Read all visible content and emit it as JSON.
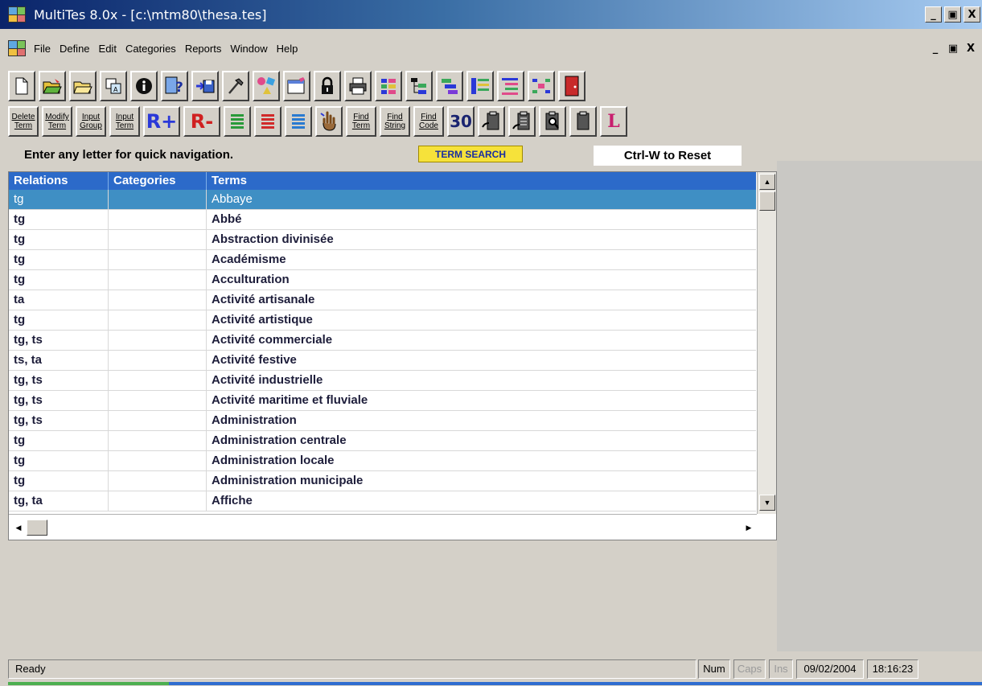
{
  "window": {
    "title": "MultiTes 8.0x - [c:\\mtm80\\thesa.tes]",
    "controls": [
      "_",
      "▣",
      "X"
    ]
  },
  "menubar": {
    "items": [
      "File",
      "Define",
      "Edit",
      "Categories",
      "Reports",
      "Window",
      "Help"
    ],
    "mdi_controls": [
      "_",
      "▣",
      "X"
    ]
  },
  "toolbar2": {
    "delete_term": [
      "Delete",
      "Term"
    ],
    "modify_term": [
      "Modify",
      "Term"
    ],
    "input_group": [
      "Input",
      "Group"
    ],
    "input_term": [
      "Input",
      "Term"
    ],
    "r_plus": "R+",
    "r_minus": "R-",
    "find_term": [
      "Find",
      "Term"
    ],
    "find_string": [
      "Find",
      "String"
    ],
    "find_code": [
      "Find",
      "Code"
    ],
    "thirty": "30",
    "letter_l": "L"
  },
  "hints": {
    "navigation": "Enter any letter for quick navigation.",
    "mode": "TERM SEARCH",
    "reset": "Ctrl-W to Reset"
  },
  "grid": {
    "columns": [
      "Relations",
      "Categories",
      "Terms"
    ],
    "rows": [
      {
        "relations": "tg",
        "categories": "",
        "term": "Abbaye",
        "selected": true
      },
      {
        "relations": "tg",
        "categories": "",
        "term": "Abbé"
      },
      {
        "relations": "tg",
        "categories": "",
        "term": "Abstraction divinisée"
      },
      {
        "relations": "tg",
        "categories": "",
        "term": "Académisme"
      },
      {
        "relations": "tg",
        "categories": "",
        "term": "Acculturation"
      },
      {
        "relations": "ta",
        "categories": "",
        "term": "Activité artisanale"
      },
      {
        "relations": "tg",
        "categories": "",
        "term": "Activité artistique"
      },
      {
        "relations": "tg, ts",
        "categories": "",
        "term": "Activité commerciale"
      },
      {
        "relations": "ts, ta",
        "categories": "",
        "term": "Activité festive"
      },
      {
        "relations": "tg, ts",
        "categories": "",
        "term": "Activité industrielle"
      },
      {
        "relations": "tg, ts",
        "categories": "",
        "term": "Activité maritime et fluviale"
      },
      {
        "relations": "tg, ts",
        "categories": "",
        "term": "Administration"
      },
      {
        "relations": "tg",
        "categories": "",
        "term": "Administration centrale"
      },
      {
        "relations": "tg",
        "categories": "",
        "term": "Administration locale"
      },
      {
        "relations": "tg",
        "categories": "",
        "term": "Administration municipale"
      },
      {
        "relations": "tg, ta",
        "categories": "",
        "term": "Affiche"
      }
    ]
  },
  "statusbar": {
    "status": "Ready",
    "num": "Num",
    "caps": "Caps",
    "ins": "Ins",
    "date": "09/02/2004",
    "time": "18:16:23"
  },
  "colors": {
    "header": "#2c6ac9",
    "selected_row": "#3f8fc4",
    "term_search_bg": "#f6e23a"
  }
}
